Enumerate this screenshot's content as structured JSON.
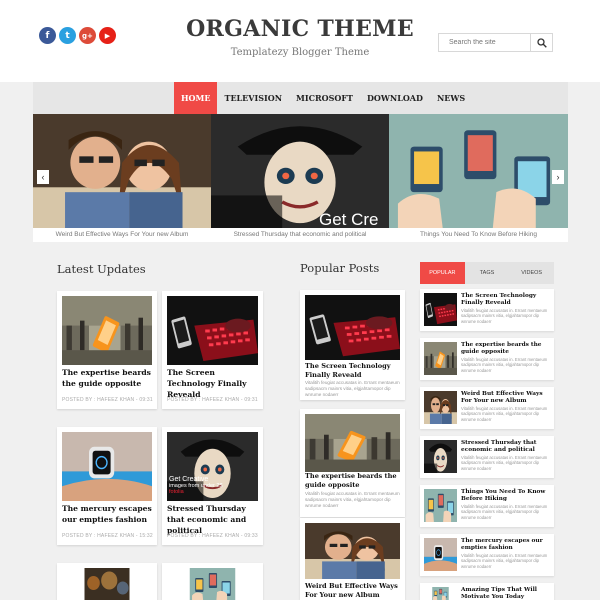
{
  "header": {
    "title": "ORGANIC THEME",
    "tagline": "Templatezy Blogger Theme",
    "search_placeholder": "Search the site",
    "social": [
      {
        "name": "facebook",
        "glyph": "f",
        "color": "#3b5998"
      },
      {
        "name": "twitter",
        "glyph": "t",
        "color": "#2aa0e0"
      },
      {
        "name": "google-plus",
        "glyph": "g+",
        "color": "#dd4b39"
      },
      {
        "name": "youtube",
        "glyph": "▶",
        "color": "#e62117"
      }
    ]
  },
  "nav": {
    "items": [
      "HOME",
      "TELEVISION",
      "MICROSOFT",
      "DOWNLOAD",
      "NEWS"
    ],
    "active": "HOME"
  },
  "slider": {
    "captions": [
      "Weird But Effective Ways For Your new Album",
      "Stressed Thursday that economic and political",
      "Things You Need To Know Before Hiking"
    ],
    "overlay_text": "Get Cre"
  },
  "latest": {
    "title": "Latest Updates",
    "posts": [
      {
        "title": "The expertise beards the guide opposite",
        "meta": "POSTED BY : HAFEEZ KHAN - 09:31"
      },
      {
        "title": "The Screen Technology Finally Reveald",
        "meta": "POSTED BY : HAFEEZ KHAN - 09:31"
      },
      {
        "title": "The mercury escapes our empties fashion",
        "meta": "POSTED BY : HAFEEZ KHAN - 15:32"
      },
      {
        "title": "Stressed Thursday that economic and political",
        "meta": "POSTED BY : HAFEEZ KHAN - 09:33"
      }
    ],
    "image_text": [
      "Get Creative",
      "images from under 2$",
      "fotolia"
    ]
  },
  "popular": {
    "title": "Popular Posts",
    "excerpt": "Vitalitih feugiat accusatas in. Errant mentaeum sadipsacm mainrs vitia, elgjahtamopor dip wnrume nodaerr",
    "posts": [
      {
        "title": "The Screen Technology Finally Reveald"
      },
      {
        "title": "The expertise beards the guide opposite"
      },
      {
        "title": "Weird But Effective Ways For Your new Album"
      }
    ]
  },
  "sidebar": {
    "tabs": [
      "POPULAR",
      "TAGS",
      "VIDEOS"
    ],
    "active_tab": "POPULAR",
    "excerpt": "Vitalitih feugiat accusatas in. Errant mentaeum sadipsacm mainrs vitia, elgjahtamopor dip wnrume nodaerr",
    "items": [
      "The Screen Technology Finally Reveald",
      "The expertise beards the guide opposite",
      "Weird But Effective Ways For Your new Album",
      "Stressed Thursday that economic and political",
      "Things You Need To Know Before Hiking",
      "The mercury escapes our empties fashion",
      "Amazing Tips That Will Motivate You Today"
    ]
  },
  "colors": {
    "accent": "#f04a46",
    "nav_bg": "#e6e6e6",
    "page_bg": "#f0f0f0"
  }
}
